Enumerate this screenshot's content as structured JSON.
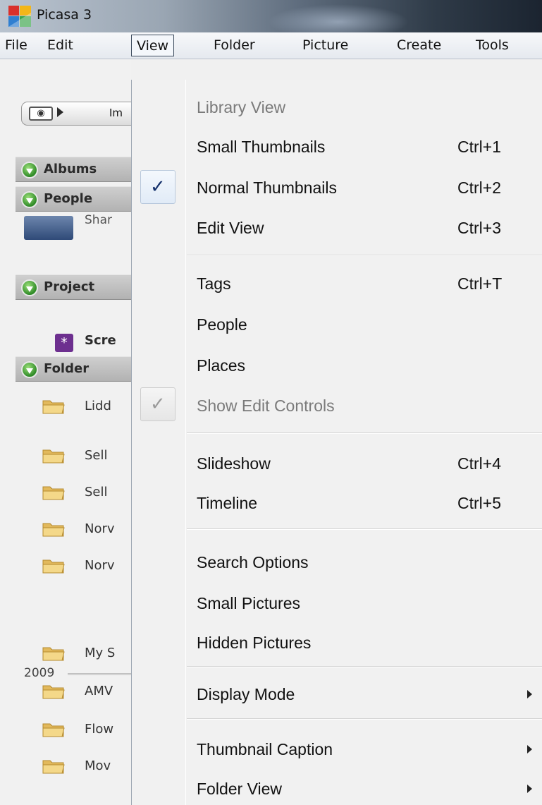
{
  "window": {
    "title": "Picasa 3"
  },
  "menubar": [
    {
      "label": "File",
      "active": false
    },
    {
      "label": "Edit",
      "active": false
    },
    {
      "label": "View",
      "active": true
    },
    {
      "label": "Folder",
      "active": false
    },
    {
      "label": "Picture",
      "active": false
    },
    {
      "label": "Create",
      "active": false
    },
    {
      "label": "Tools",
      "active": false
    }
  ],
  "sidebar": {
    "import_button": {
      "label": "Im"
    },
    "sections": {
      "albums": "Albums",
      "people": "People",
      "projects": "Project",
      "folders": "Folder"
    },
    "person_name": "Shar",
    "project_item": "Scre",
    "year": "2009",
    "folders_before_year": [
      "Lidd",
      "Sell",
      "Sell",
      "Norv",
      "Norv"
    ],
    "folders_after_year": [
      "My S",
      "AMV",
      "Flow",
      "Mov"
    ]
  },
  "view_menu": {
    "items": [
      {
        "label": "Library View",
        "shortcut": "",
        "disabled": true,
        "checked": false,
        "submenu": false
      },
      {
        "label": "Small Thumbnails",
        "shortcut": "Ctrl+1",
        "disabled": false,
        "checked": false,
        "submenu": false
      },
      {
        "label": "Normal Thumbnails",
        "shortcut": "Ctrl+2",
        "disabled": false,
        "checked": true,
        "submenu": false
      },
      {
        "label": "Edit View",
        "shortcut": "Ctrl+3",
        "disabled": false,
        "checked": false,
        "submenu": false
      },
      {
        "label": "Tags",
        "shortcut": "Ctrl+T",
        "disabled": false,
        "checked": false,
        "submenu": false
      },
      {
        "label": "People",
        "shortcut": "",
        "disabled": false,
        "checked": false,
        "submenu": false
      },
      {
        "label": "Places",
        "shortcut": "",
        "disabled": false,
        "checked": false,
        "submenu": false
      },
      {
        "label": "Show Edit Controls",
        "shortcut": "",
        "disabled": true,
        "checked": true,
        "submenu": false
      },
      {
        "label": "Slideshow",
        "shortcut": "Ctrl+4",
        "disabled": false,
        "checked": false,
        "submenu": false
      },
      {
        "label": "Timeline",
        "shortcut": "Ctrl+5",
        "disabled": false,
        "checked": false,
        "submenu": false
      },
      {
        "label": "Search Options",
        "shortcut": "",
        "disabled": false,
        "checked": false,
        "submenu": false
      },
      {
        "label": "Small Pictures",
        "shortcut": "",
        "disabled": false,
        "checked": false,
        "submenu": false
      },
      {
        "label": "Hidden Pictures",
        "shortcut": "",
        "disabled": false,
        "checked": false,
        "submenu": false
      },
      {
        "label": "Display Mode",
        "shortcut": "",
        "disabled": false,
        "checked": false,
        "submenu": true
      },
      {
        "label": "Thumbnail Caption",
        "shortcut": "",
        "disabled": false,
        "checked": false,
        "submenu": true
      },
      {
        "label": "Folder View",
        "shortcut": "",
        "disabled": false,
        "checked": false,
        "submenu": true
      }
    ]
  }
}
